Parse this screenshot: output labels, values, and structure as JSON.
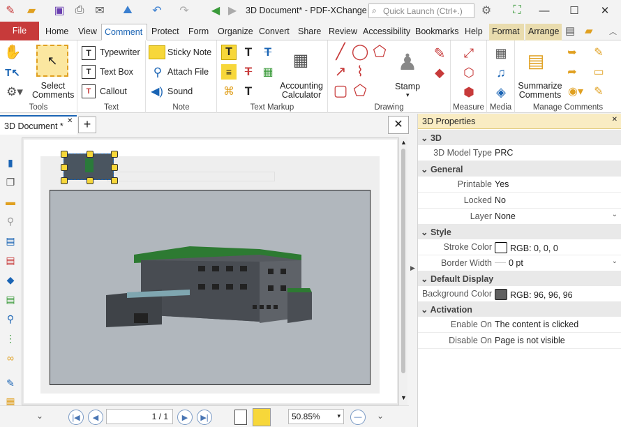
{
  "titlebar": {
    "title": "3D Document* - PDF-XChange ...",
    "quick_launch_placeholder": "Quick Launch (Ctrl+.)",
    "accent": "#c73a3a"
  },
  "menu": {
    "file": "File",
    "home": "Home",
    "view": "View",
    "comment": "Comment",
    "protect": "Protect",
    "form": "Form",
    "organize": "Organize",
    "convert": "Convert",
    "share": "Share",
    "review": "Review",
    "accessibility": "Accessibility",
    "bookmarks": "Bookmarks",
    "help": "Help",
    "format": "Format",
    "arrange": "Arrange"
  },
  "ribbon": {
    "tools": {
      "select_comments": "Select Comments",
      "label": "Tools"
    },
    "text": {
      "typewriter": "Typewriter",
      "text_box": "Text Box",
      "callout": "Callout",
      "label": "Text"
    },
    "note": {
      "sticky_note": "Sticky Note",
      "attach_file": "Attach File",
      "sound": "Sound",
      "label": "Note"
    },
    "markup": {
      "accounting_calculator": "Accounting Calculator",
      "label": "Text Markup"
    },
    "drawing": {
      "stamp": "Stamp",
      "label": "Drawing"
    },
    "measure": {
      "label": "Measure"
    },
    "media": {
      "label": "Media"
    },
    "manage": {
      "summarize_comments": "Summarize Comments",
      "label": "Manage Comments"
    }
  },
  "doc": {
    "tab": "3D Document *"
  },
  "bottom": {
    "page": "1",
    "page_total": "/ 1",
    "zoom": "50.85%"
  },
  "props": {
    "title": "3D Properties",
    "sections": {
      "s3d": "3D",
      "general": "General",
      "style": "Style",
      "default_display": "Default Display",
      "activation": "Activation"
    },
    "rows": {
      "model_type_label": "3D Model Type",
      "model_type": "PRC",
      "printable_label": "Printable",
      "printable": "Yes",
      "locked_label": "Locked",
      "locked": "No",
      "layer_label": "Layer",
      "layer": "None",
      "stroke_label": "Stroke Color",
      "stroke": "RGB: 0, 0, 0",
      "border_label": "Border Width",
      "border": "0 pt",
      "bg_label": "Background Color",
      "bg": "RGB: 96, 96, 96",
      "enable_label": "Enable On",
      "enable": "The content is clicked",
      "disable_label": "Disable On",
      "disable": "Page is not visible"
    },
    "stroke_color": "#000000",
    "bg_color": "#606060"
  }
}
